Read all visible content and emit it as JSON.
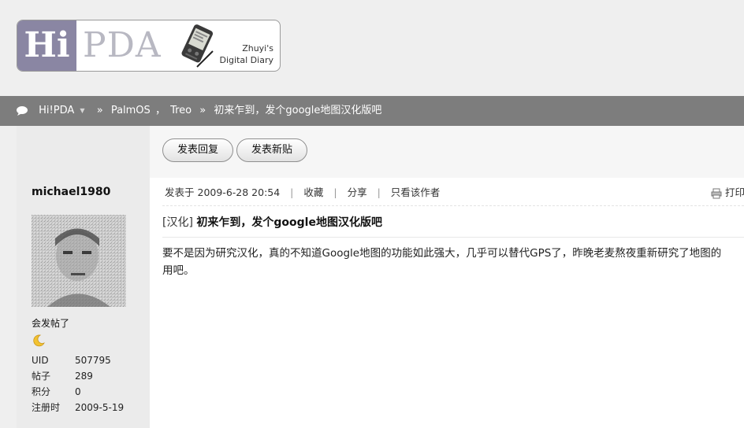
{
  "logo": {
    "hi": "Hi",
    "pda": "PDA",
    "tagline_line1": "Zhuyi's",
    "tagline_line2": "Digital Diary",
    "colors": {
      "hi_bg": "#8a86a3",
      "pda_text": "#b8b8c2"
    }
  },
  "breadcrumb": {
    "home": "Hi!PDA",
    "separator": "»",
    "forum_part1": "PalmOS",
    "comma": "，",
    "forum_part2": "Treo",
    "current": "初来乍到，发个google地图汉化版吧"
  },
  "toolbar": {
    "reply_label": "发表回复",
    "newpost_label": "发表新贴"
  },
  "author": {
    "name": "michael1980",
    "title": "会发帖了",
    "stats": [
      {
        "key": "UID",
        "value": "507795"
      },
      {
        "key": "帖子",
        "value": "289"
      },
      {
        "key": "积分",
        "value": "0"
      },
      {
        "key": "注册时",
        "value": "2009-5-19"
      }
    ]
  },
  "post": {
    "posted_prefix": "发表于",
    "posted_time": "2009-6-28 20:54",
    "favorite": "收藏",
    "share": "分享",
    "only_author": "只看该作者",
    "print": "打印",
    "category": "[汉化]",
    "title": "初来乍到，发个google地图汉化版吧",
    "body_line1": "要不是因为研究汉化，真的不知道Google地图的功能如此强大，几乎可以替代GPS了，昨晚老麦熬夜重新研究了地图的",
    "body_line2": "用吧。"
  },
  "colors": {
    "navbar_bg": "#7d7d7d",
    "page_bg": "#efefef",
    "sidebar_bg": "#ebebeb"
  }
}
